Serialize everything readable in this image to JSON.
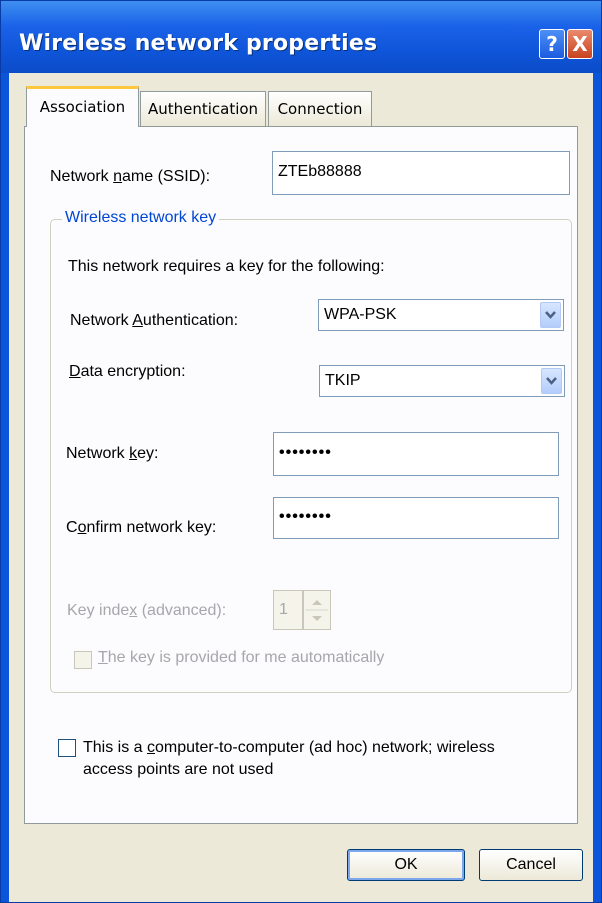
{
  "window": {
    "title": "Wireless network properties",
    "help_glyph": "?",
    "close_glyph": "X"
  },
  "tabs": [
    {
      "label": "Association",
      "active": true
    },
    {
      "label": "Authentication",
      "active": false
    },
    {
      "label": "Connection",
      "active": false
    }
  ],
  "association": {
    "ssid": {
      "label_pre": "Network ",
      "label_key": "n",
      "label_post": "ame (SSID):",
      "value": "ZTEb88888"
    },
    "group_title": "Wireless network key",
    "requires_text": "This network requires a key for the following:",
    "auth": {
      "label_pre": "Network ",
      "label_key": "A",
      "label_post": "uthentication:",
      "value": "WPA-PSK"
    },
    "encryption": {
      "label_pre": "",
      "label_key": "D",
      "label_post": "ata encryption:",
      "value": "TKIP"
    },
    "network_key": {
      "label_pre": "Network ",
      "label_key": "k",
      "label_post": "ey:",
      "value": "••••••••"
    },
    "confirm_key": {
      "label_pre": "C",
      "label_key": "o",
      "label_post": "nfirm network key:",
      "value": "••••••••"
    },
    "key_index": {
      "label_pre": "Key inde",
      "label_key": "x",
      "label_post": " (advanced):",
      "value": "1"
    },
    "auto_key": {
      "label_pre": "",
      "label_key": "T",
      "label_post": "he key is provided for me automatically",
      "checked": false
    },
    "adhoc": {
      "label_pre": "This is a ",
      "label_key": "c",
      "label_post": "omputer-to-computer (ad hoc) network; wireless",
      "line2": "access points are not used",
      "checked": false
    }
  },
  "buttons": {
    "ok": "OK",
    "cancel": "Cancel"
  },
  "colors": {
    "titlebar": "#0b56d8",
    "face": "#ece9d8",
    "tab_highlight": "#ffc83c",
    "group_title": "#0046d5"
  }
}
